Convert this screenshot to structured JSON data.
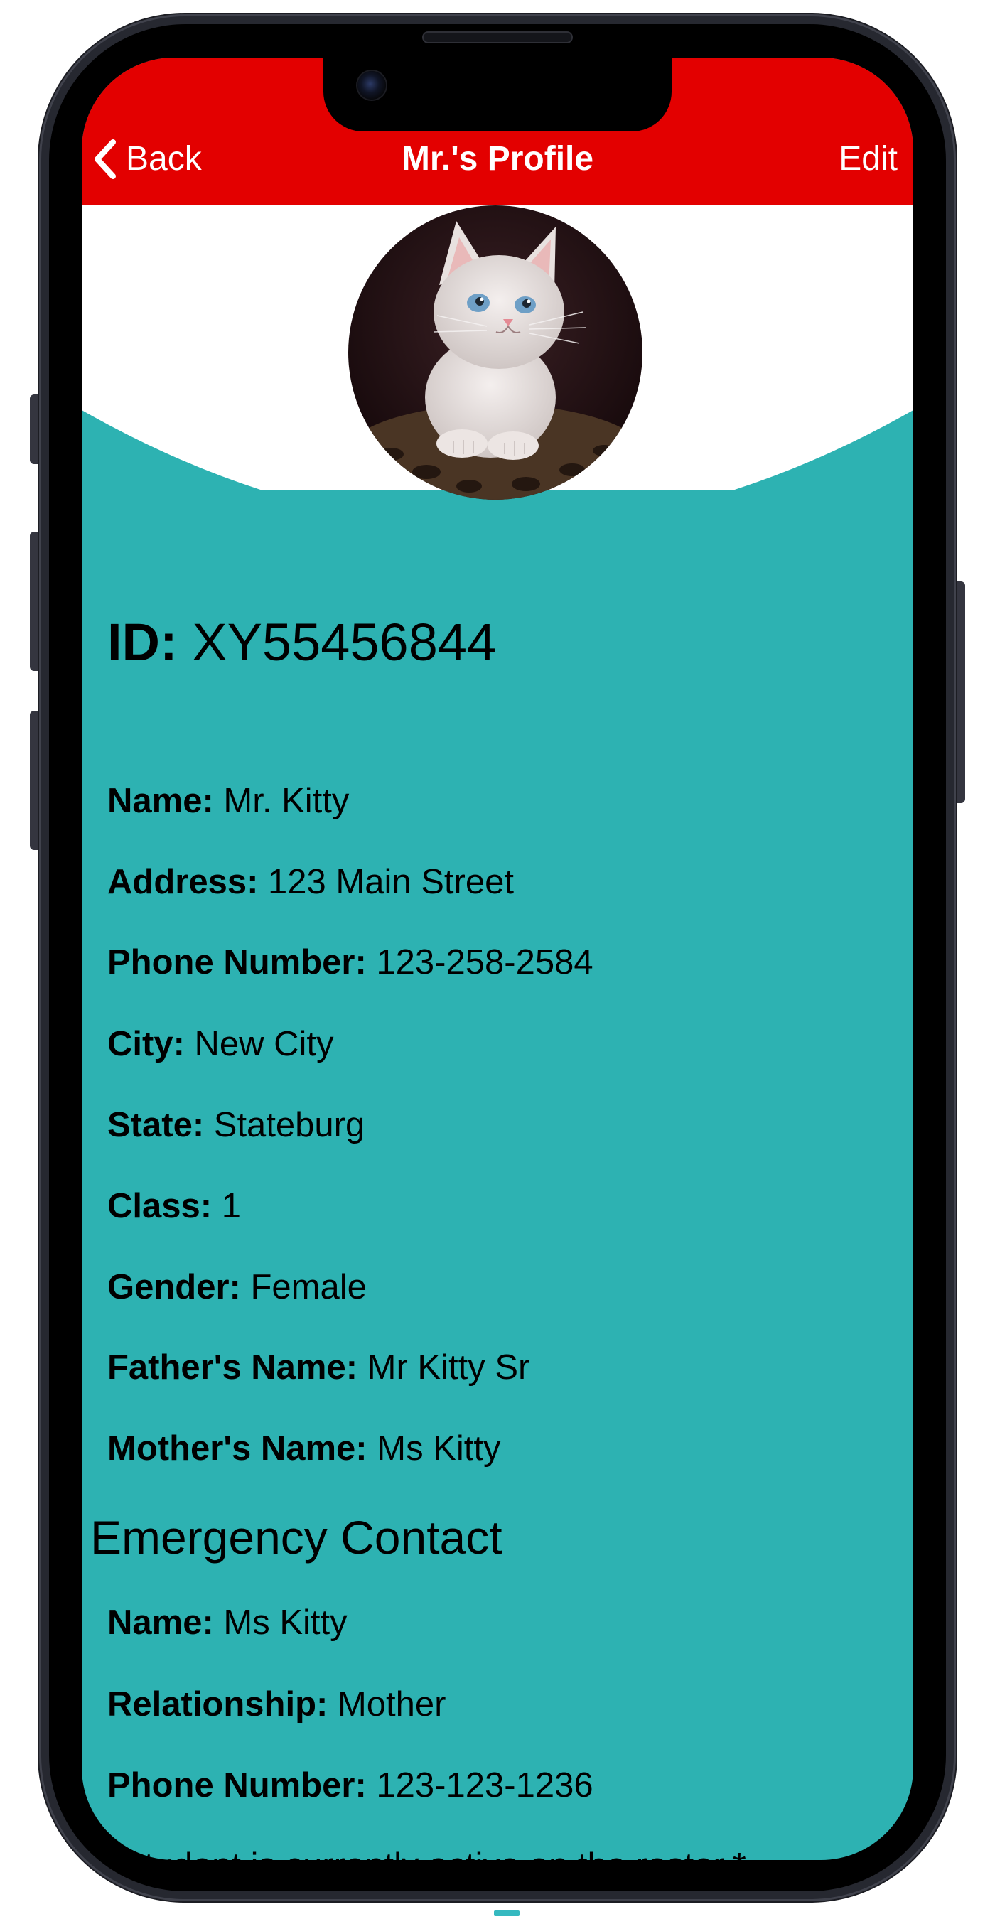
{
  "nav": {
    "back_label": "Back",
    "title": "Mr.'s Profile",
    "edit_label": "Edit",
    "back_icon": "chevron-left-icon"
  },
  "colors": {
    "nav_background": "#e30000",
    "content_background": "#2db2b2",
    "header_background": "#ffffff"
  },
  "profile": {
    "photo": "kitten-avatar",
    "id_label": "ID:",
    "id_value": "XY55456844",
    "fields": [
      {
        "label": "Name:",
        "value": "Mr. Kitty"
      },
      {
        "label": "Address:",
        "value": "123 Main Street"
      },
      {
        "label": "Phone Number:",
        "value": "123-258-2584"
      },
      {
        "label": "City:",
        "value": "New City"
      },
      {
        "label": "State:",
        "value": "Stateburg"
      },
      {
        "label": "Class:",
        "value": "1"
      },
      {
        "label": "Gender:",
        "value": "Female"
      },
      {
        "label": "Father's Name:",
        "value": "Mr Kitty Sr"
      },
      {
        "label": "Mother's Name:",
        "value": "Ms Kitty"
      }
    ]
  },
  "emergency": {
    "title": "Emergency Contact",
    "fields": [
      {
        "label": "Name:",
        "value": "Ms Kitty"
      },
      {
        "label": "Relationship:",
        "value": "Mother"
      },
      {
        "label": "Phone Number:",
        "value": "123-123-1236"
      }
    ]
  },
  "note": "*Student is currently active on the roster.*"
}
